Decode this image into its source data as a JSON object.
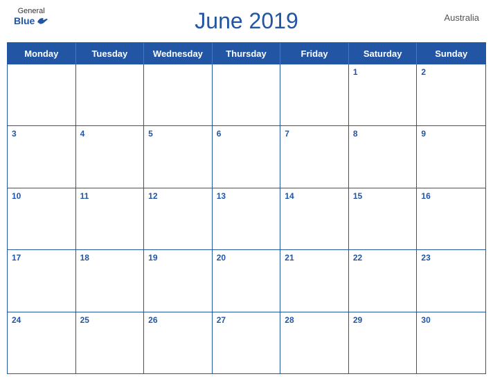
{
  "header": {
    "logo": {
      "general": "General",
      "blue": "Blue"
    },
    "title": "June 2019",
    "country": "Australia"
  },
  "calendar": {
    "dayHeaders": [
      "Monday",
      "Tuesday",
      "Wednesday",
      "Thursday",
      "Friday",
      "Saturday",
      "Sunday"
    ],
    "weeks": [
      [
        {
          "date": "",
          "empty": true
        },
        {
          "date": "",
          "empty": true
        },
        {
          "date": "",
          "empty": true
        },
        {
          "date": "",
          "empty": true
        },
        {
          "date": "",
          "empty": true
        },
        {
          "date": "1",
          "empty": false
        },
        {
          "date": "2",
          "empty": false
        }
      ],
      [
        {
          "date": "3",
          "empty": false
        },
        {
          "date": "4",
          "empty": false
        },
        {
          "date": "5",
          "empty": false
        },
        {
          "date": "6",
          "empty": false
        },
        {
          "date": "7",
          "empty": false
        },
        {
          "date": "8",
          "empty": false
        },
        {
          "date": "9",
          "empty": false
        }
      ],
      [
        {
          "date": "10",
          "empty": false
        },
        {
          "date": "11",
          "empty": false
        },
        {
          "date": "12",
          "empty": false
        },
        {
          "date": "13",
          "empty": false
        },
        {
          "date": "14",
          "empty": false
        },
        {
          "date": "15",
          "empty": false
        },
        {
          "date": "16",
          "empty": false
        }
      ],
      [
        {
          "date": "17",
          "empty": false
        },
        {
          "date": "18",
          "empty": false
        },
        {
          "date": "19",
          "empty": false
        },
        {
          "date": "20",
          "empty": false
        },
        {
          "date": "21",
          "empty": false
        },
        {
          "date": "22",
          "empty": false
        },
        {
          "date": "23",
          "empty": false
        }
      ],
      [
        {
          "date": "24",
          "empty": false
        },
        {
          "date": "25",
          "empty": false
        },
        {
          "date": "26",
          "empty": false
        },
        {
          "date": "27",
          "empty": false
        },
        {
          "date": "28",
          "empty": false
        },
        {
          "date": "29",
          "empty": false
        },
        {
          "date": "30",
          "empty": false
        }
      ]
    ]
  }
}
